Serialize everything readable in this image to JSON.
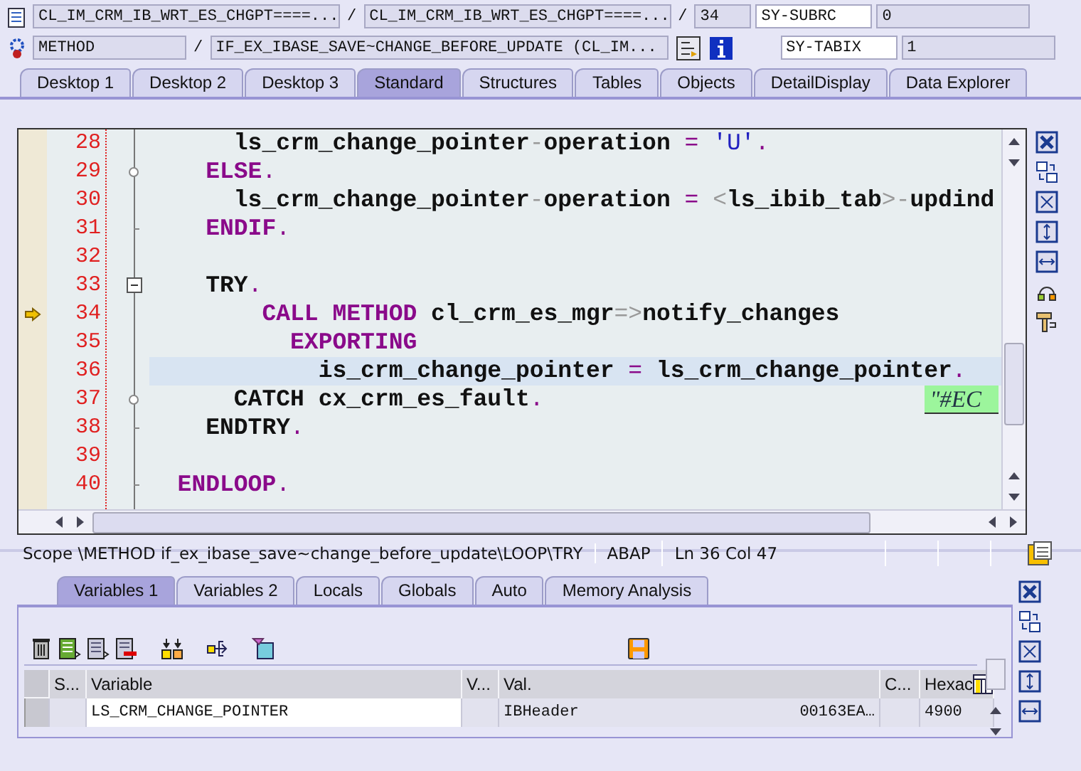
{
  "header": {
    "row_1": {
      "program": "CL_IM_CRM_IB_WRT_ES_CHGPT====...",
      "separator_1": "/",
      "include": "CL_IM_CRM_IB_WRT_ES_CHGPT====...",
      "separator_2": "/",
      "line": "34",
      "system_field": "SY-SUBRC",
      "system_value": "0"
    },
    "row_2": {
      "event_type": "METHOD",
      "separator": "/",
      "event": "IF_EX_IBASE_SAVE~CHANGE_BEFORE_UPDATE (CL_IM...",
      "system_field": "SY-TABIX",
      "system_value": "1"
    }
  },
  "tabs": [
    {
      "label": "Desktop 1",
      "selected": false
    },
    {
      "label": "Desktop 2",
      "selected": false
    },
    {
      "label": "Desktop 3",
      "selected": false
    },
    {
      "label": "Standard",
      "selected": true
    },
    {
      "label": "Structures",
      "selected": false
    },
    {
      "label": "Tables",
      "selected": false
    },
    {
      "label": "Objects",
      "selected": false
    },
    {
      "label": "DetailDisplay",
      "selected": false
    },
    {
      "label": "Data Explorer",
      "selected": false
    }
  ],
  "editor": {
    "lines": [
      {
        "number": "28",
        "kind": "line",
        "current": false,
        "highlighted": false,
        "tokens": [
          {
            "kind": "id",
            "text": "      ls_crm_change_pointer"
          },
          {
            "kind": "sym",
            "text": "-"
          },
          {
            "kind": "id",
            "text": "operation"
          },
          {
            "kind": "op",
            "text": " = "
          },
          {
            "kind": "str",
            "text": "'U'"
          },
          {
            "kind": "op",
            "text": "."
          }
        ]
      },
      {
        "number": "29",
        "kind": "branch",
        "current": false,
        "highlighted": false,
        "tokens": [
          {
            "kind": "kw",
            "text": "    ELSE"
          },
          {
            "kind": "op",
            "text": "."
          }
        ]
      },
      {
        "number": "30",
        "kind": "line",
        "current": false,
        "highlighted": false,
        "tokens": [
          {
            "kind": "id",
            "text": "      ls_crm_change_pointer"
          },
          {
            "kind": "sym",
            "text": "-"
          },
          {
            "kind": "id",
            "text": "operation"
          },
          {
            "kind": "op",
            "text": " = "
          },
          {
            "kind": "sym",
            "text": "<"
          },
          {
            "kind": "id",
            "text": "ls_ibib_tab"
          },
          {
            "kind": "sym",
            "text": ">-"
          },
          {
            "kind": "id",
            "text": "updind"
          }
        ]
      },
      {
        "number": "31",
        "kind": "end",
        "current": false,
        "highlighted": false,
        "tokens": [
          {
            "kind": "kw",
            "text": "    ENDIF"
          },
          {
            "kind": "op",
            "text": "."
          }
        ]
      },
      {
        "number": "32",
        "kind": "line",
        "current": false,
        "highlighted": false
      },
      {
        "number": "33",
        "kind": "collapse",
        "current": false,
        "highlighted": false,
        "tokens": [
          {
            "kind": "id",
            "text": "    TRY"
          },
          {
            "kind": "op",
            "text": "."
          }
        ]
      },
      {
        "number": "34",
        "kind": "line",
        "current": true,
        "highlighted": false,
        "tokens": [
          {
            "kind": "kw",
            "text": "        CALL METHOD"
          },
          {
            "kind": "id",
            "text": " cl_crm_es_mgr"
          },
          {
            "kind": "sym",
            "text": "=>"
          },
          {
            "kind": "id",
            "text": "notify_changes"
          }
        ]
      },
      {
        "number": "35",
        "kind": "line",
        "current": false,
        "highlighted": false,
        "tokens": [
          {
            "kind": "kw",
            "text": "          EXPORTING"
          }
        ]
      },
      {
        "number": "36",
        "kind": "line",
        "current": false,
        "highlighted": true,
        "tokens": [
          {
            "kind": "id",
            "text": "            is_crm_change_pointer"
          },
          {
            "kind": "op",
            "text": " = "
          },
          {
            "kind": "id",
            "text": "ls_crm_change_pointer"
          },
          {
            "kind": "op",
            "text": "."
          }
        ]
      },
      {
        "number": "37",
        "kind": "branch",
        "current": false,
        "highlighted": false,
        "pragma": "\"#EC",
        "tokens": [
          {
            "kind": "id",
            "text": "      CATCH cx_crm_es_fault"
          },
          {
            "kind": "op",
            "text": "."
          }
        ]
      },
      {
        "number": "38",
        "kind": "end",
        "current": false,
        "highlighted": false,
        "tokens": [
          {
            "kind": "id",
            "text": "    ENDTRY"
          },
          {
            "kind": "op",
            "text": "."
          }
        ]
      },
      {
        "number": "39",
        "kind": "line",
        "current": false,
        "highlighted": false
      },
      {
        "number": "40",
        "kind": "end",
        "current": false,
        "highlighted": false,
        "tokens": [
          {
            "kind": "kw",
            "text": "  ENDLOOP"
          },
          {
            "kind": "op",
            "text": "."
          }
        ]
      }
    ]
  },
  "status_bar": {
    "scope": "Scope \\METHOD if_ex_ibase_save~change_before_update\\LOOP\\TRY",
    "language": "ABAP",
    "position": "Ln  36 Col  47"
  },
  "variable_tabs": [
    {
      "label": "Variables 1",
      "selected": true
    },
    {
      "label": "Variables 2",
      "selected": false
    },
    {
      "label": "Locals",
      "selected": false
    },
    {
      "label": "Globals",
      "selected": false
    },
    {
      "label": "Auto",
      "selected": false
    },
    {
      "label": "Memory Analysis",
      "selected": false
    }
  ],
  "variables_table": {
    "columns": [
      "S...",
      "Variable",
      "V...",
      "Val.",
      "C...",
      "Hexac"
    ],
    "rows": [
      {
        "status": "",
        "variable": "LS_CRM_CHANGE_POINTER",
        "v": "",
        "value": "IBHeader",
        "value_reference": "00163EA…",
        "c": "",
        "hexadecimal": "4900"
      }
    ]
  }
}
